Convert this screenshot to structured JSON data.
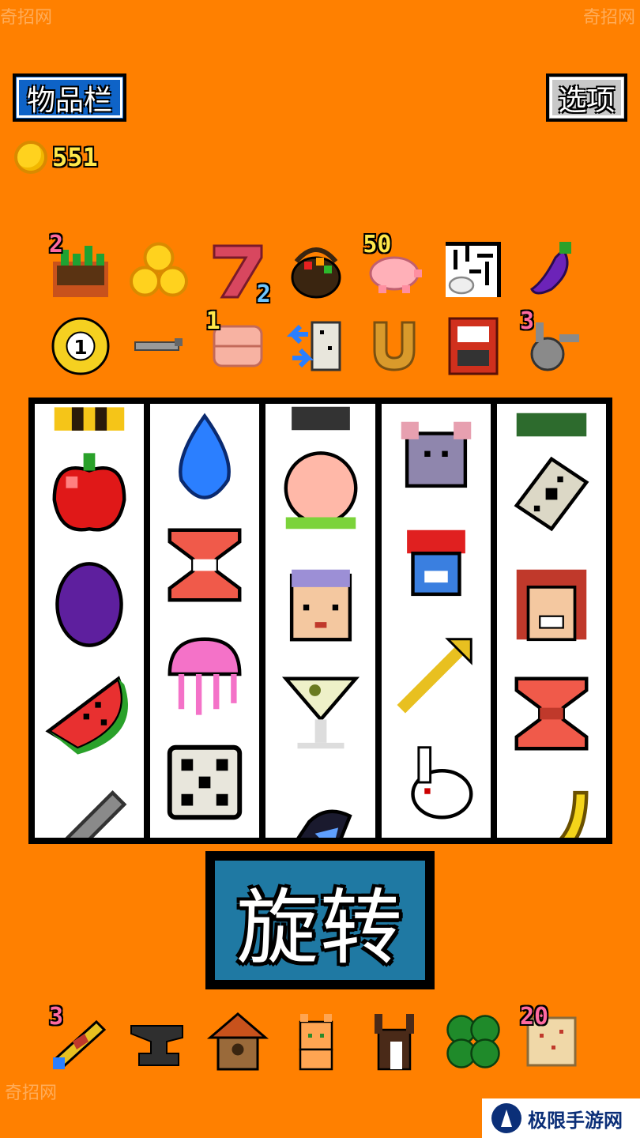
{
  "header": {
    "inventory_label": "物品栏",
    "options_label": "选项"
  },
  "coins": {
    "count": "551"
  },
  "items_row1": [
    {
      "name": "planter-box-icon",
      "count": "2",
      "badge_pos": "tl",
      "badge_color": "pink"
    },
    {
      "name": "coin-pile-icon",
      "count": "",
      "badge_pos": "",
      "badge_color": ""
    },
    {
      "name": "seven-icon",
      "count": "2",
      "badge_pos": "br",
      "badge_color": "blue"
    },
    {
      "name": "fruit-basket-icon",
      "count": "",
      "badge_pos": "",
      "badge_color": ""
    },
    {
      "name": "piggy-bank-icon",
      "count": "50",
      "badge_pos": "tl",
      "badge_color": "yellow"
    },
    {
      "name": "rabbit-maze-icon",
      "count": "",
      "badge_pos": "",
      "badge_color": ""
    },
    {
      "name": "eggplant-icon",
      "count": "",
      "badge_pos": "",
      "badge_color": ""
    }
  ],
  "items_row2": [
    {
      "name": "billiard-ball-icon",
      "label": "1",
      "count": "",
      "badge_pos": "",
      "badge_color": ""
    },
    {
      "name": "dagger-icon",
      "count": "",
      "badge_pos": "",
      "badge_color": ""
    },
    {
      "name": "pink-bandage-icon",
      "count": "1",
      "badge_pos": "tl",
      "badge_color": "yellow"
    },
    {
      "name": "dice-swap-icon",
      "count": "",
      "badge_pos": "",
      "badge_color": ""
    },
    {
      "name": "horseshoe-icon",
      "count": "",
      "badge_pos": "",
      "badge_color": ""
    },
    {
      "name": "red-cabinet-icon",
      "count": "",
      "badge_pos": "",
      "badge_color": ""
    },
    {
      "name": "gray-rabbit-icon",
      "count": "3",
      "badge_pos": "tl",
      "badge_color": "pink"
    }
  ],
  "reels": [
    [
      "partial-bee-icon",
      "apple-icon",
      "plum-icon",
      "watermelon-icon",
      "sword-icon"
    ],
    [
      "water-drop-icon",
      "red-hourglass-icon",
      "jellyfish-icon",
      "dice-icon"
    ],
    [
      "partial-dark-icon",
      "peach-icon",
      "granny-icon",
      "martini-icon",
      "magpie-icon"
    ],
    [
      "mouse-icon",
      "jester-icon",
      "golden-arrow-icon",
      "white-rabbit-icon"
    ],
    [
      "partial-green-icon",
      "stone-tablet-icon",
      "laughing-girl-icon",
      "red-hourglass-icon",
      "banana-icon"
    ]
  ],
  "spin": {
    "label": "旋转"
  },
  "bottom_items": [
    {
      "name": "telescope-icon",
      "count": "3"
    },
    {
      "name": "anvil-icon",
      "count": ""
    },
    {
      "name": "birdhouse-icon",
      "count": ""
    },
    {
      "name": "orange-cat-icon",
      "count": ""
    },
    {
      "name": "brown-rabbit-icon",
      "count": ""
    },
    {
      "name": "four-leaf-clover-icon",
      "count": ""
    },
    {
      "name": "treasure-map-icon",
      "count": "20"
    }
  ],
  "watermark": {
    "text": "奇招网",
    "site": "极限手游网"
  }
}
